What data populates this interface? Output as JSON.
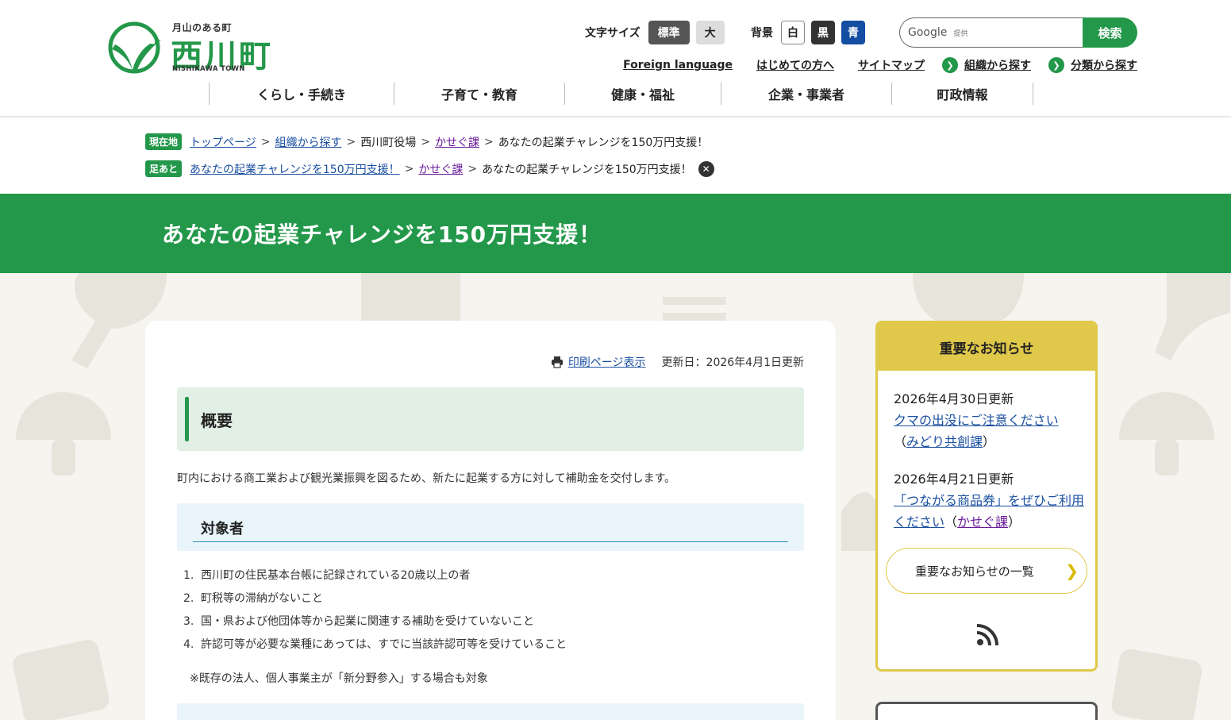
{
  "header": {
    "logo": {
      "tagline": "月山のある町",
      "name": "西川町",
      "roman": "NISHIKAWA TOWN"
    },
    "font_size": {
      "label": "文字サイズ",
      "standard": "標準",
      "large": "大"
    },
    "background": {
      "label": "背景",
      "white": "白",
      "black": "黒",
      "blue": "青"
    },
    "search": {
      "google": "Google",
      "powered": "提供",
      "button": "検索"
    },
    "sublinks": {
      "foreign": "Foreign language",
      "first_time": "はじめての方へ",
      "sitemap": "サイトマップ",
      "by_org": "組織から探す",
      "by_category": "分類から探す"
    },
    "gnav": [
      "くらし・手続き",
      "子育て・教育",
      "健康・福祉",
      "企業・事業者",
      "町政情報"
    ]
  },
  "breadcrumb": {
    "here_badge": "現在地",
    "here": [
      "トップページ",
      "組織から探す",
      "西川町役場",
      "かせぐ課",
      "あなたの起業チャレンジを150万円支援！"
    ],
    "footprint_badge": "足あと",
    "footprint": [
      "あなたの起業チャレンジを150万円支援！",
      "かせぐ課",
      "あなたの起業チャレンジを150万円支援！"
    ]
  },
  "page": {
    "title": "あなたの起業チャレンジを150万円支援！",
    "print_link": "印刷ページ表示",
    "updated": "更新日：2026年4月1日更新",
    "section_overview": "概要",
    "overview_text": "町内における商工業および観光業振興を図るため、新たに起業する方に対して補助金を交付します。",
    "section_target": "対象者",
    "target_items": [
      "西川町の住民基本台帳に記録されている20歳以上の者",
      "町税等の滞納がないこと",
      "国・県および他団体等から起業に関連する補助を受けていないこと",
      "許認可等が必要な業種にあっては、すでに当該許認可等を受けていること"
    ],
    "target_note": "※既存の法人、個人事業主が「新分野参入」する場合も対象"
  },
  "notice": {
    "title": "重要なお知らせ",
    "items": [
      {
        "date": "2026年4月30日更新",
        "link": "クマの出没にご注意ください",
        "dept": "みどり共創課"
      },
      {
        "date": "2026年4月21日更新",
        "link": "「つながる商品券」をぜひご利用ください",
        "dept": "かせぐ課"
      }
    ],
    "all_button": "重要なお知らせの一覧"
  },
  "colors": {
    "brand_green": "#23984a",
    "notice_yellow": "#e0c84a",
    "link_blue": "#1a4fa0",
    "visited_purple": "#6a1b9a",
    "bg_cream": "#f5f4ee"
  }
}
